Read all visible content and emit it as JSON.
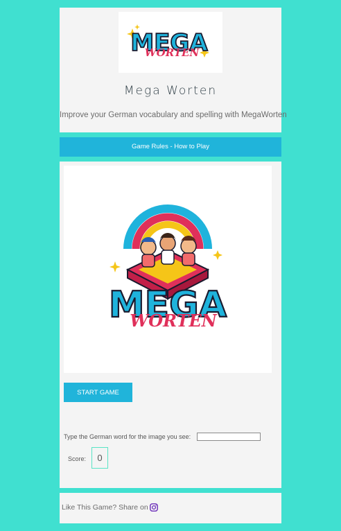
{
  "header": {
    "logo_text_1": "MEGA",
    "logo_text_2": "WORTEN",
    "title": "Mega Worten",
    "subtitle": "Improve your German vocabulary and spelling with MegaWorten"
  },
  "rules_button": {
    "label": "Game Rules - How to Play"
  },
  "game": {
    "image_text_1": "MEGA",
    "image_text_2": "WORTEN",
    "start_label": "START GAME",
    "prompt": "Type the German word for the image you see:",
    "answer_value": "",
    "score_label": "Score:",
    "score_value": "0"
  },
  "share": {
    "text": "Like This Game? Share on",
    "icon": "instagram-icon"
  },
  "colors": {
    "background": "#40e0d0",
    "panel": "#f4f4f4",
    "accent": "#20b4da",
    "logo_blue": "#1fb3dc",
    "logo_red": "#e0305a",
    "score_border": "#59e4c6",
    "instagram": "#6a2bb8"
  }
}
